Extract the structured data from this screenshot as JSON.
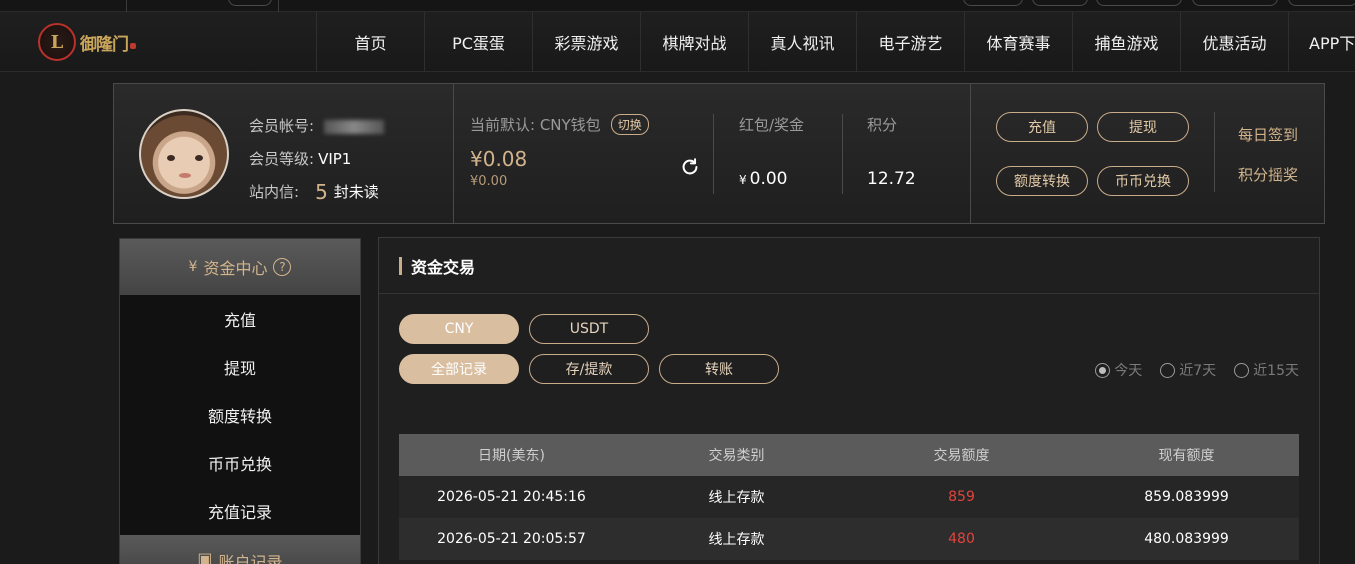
{
  "nav": {
    "logo_text": "御隆门",
    "items": [
      "首页",
      "PC蛋蛋",
      "彩票游戏",
      "棋牌对战",
      "真人视讯",
      "电子游艺",
      "体育赛事",
      "捕鱼游戏",
      "优惠活动",
      "APP下"
    ]
  },
  "profile": {
    "account_label": "会员帐号:",
    "level_label": "会员等级:",
    "level_value": "VIP1",
    "mail_label": "站内信:",
    "mail_count": "5",
    "mail_unread": "封未读"
  },
  "wallet": {
    "label": "当前默认: CNY钱包",
    "switch_label": "切换",
    "amount": "¥0.08",
    "sub_amount": "¥0.00"
  },
  "bonus": {
    "label": "红包/奖金",
    "currency": "¥",
    "value": "0.00"
  },
  "points": {
    "label": "积分",
    "value": "12.72"
  },
  "actions": {
    "deposit": "充值",
    "withdraw": "提现",
    "transfer": "额度转换",
    "exchange": "币币兑换",
    "daily_signin": "每日签到",
    "points_lottery": "积分摇奖"
  },
  "sidebar": {
    "header": "资金中心",
    "items": [
      "充值",
      "提现",
      "额度转换",
      "币币兑换",
      "充值记录"
    ],
    "header2": "账户记录"
  },
  "main": {
    "title": "资金交易",
    "currency_tabs": [
      "CNY",
      "USDT"
    ],
    "filter_tabs": [
      "全部记录",
      "存/提款",
      "转账"
    ],
    "ranges": [
      "今天",
      "近7天",
      "近15天"
    ],
    "columns": [
      "日期(美东)",
      "交易类别",
      "交易额度",
      "现有额度"
    ],
    "rows": [
      {
        "date": "2026-05-21 20:45:16",
        "type": "线上存款",
        "amount": "859",
        "balance": "859.083999"
      },
      {
        "date": "2026-05-21 20:05:57",
        "type": "线上存款",
        "amount": "480",
        "balance": "480.083999"
      }
    ]
  },
  "colors": {
    "accent": "#d2b48c",
    "active_chip": "#d9bea0",
    "negative": "#e2443b"
  }
}
